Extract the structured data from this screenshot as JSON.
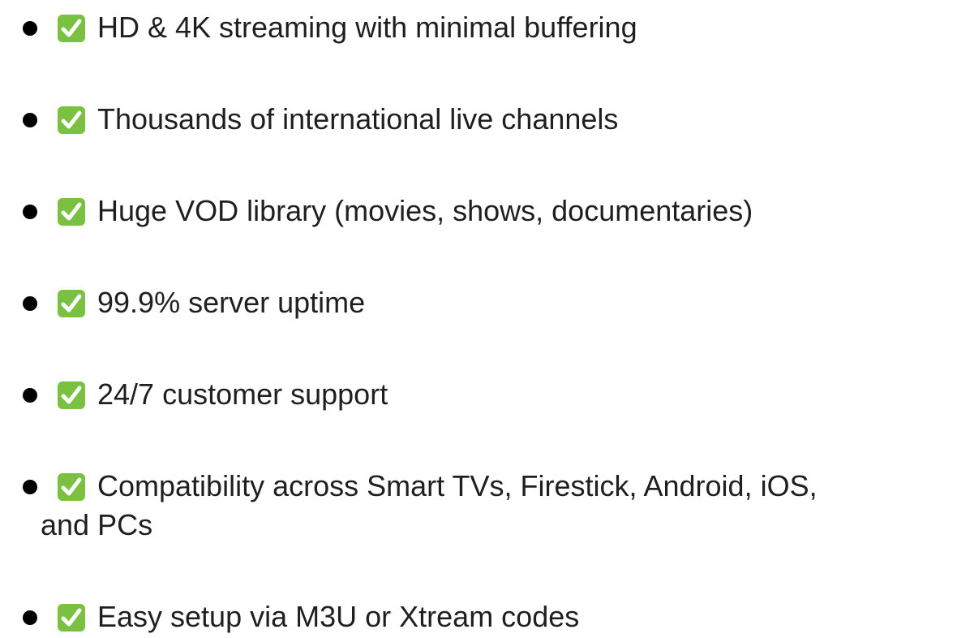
{
  "features": [
    {
      "text": "HD & 4K streaming with minimal buffering",
      "icon": "check-mark-button-icon"
    },
    {
      "text": "Thousands of international live channels",
      "icon": "check-mark-button-icon"
    },
    {
      "text": "Huge VOD library (movies, shows, documentaries)",
      "icon": "check-mark-button-icon"
    },
    {
      "text": "99.9% server uptime",
      "icon": "check-mark-button-icon"
    },
    {
      "text": "24/7 customer support",
      "icon": "check-mark-button-icon"
    },
    {
      "text": "Compatibility across Smart TVs, Firestick, Android, iOS,",
      "continuation": "and PCs",
      "icon": "check-mark-button-icon"
    },
    {
      "text": "Easy setup via M3U or Xtream codes",
      "icon": "check-mark-button-icon"
    }
  ],
  "colors": {
    "text": "#1f1f1f",
    "bullet": "#000000",
    "check_box": "#7ac142",
    "check_mark": "#ffffff"
  }
}
